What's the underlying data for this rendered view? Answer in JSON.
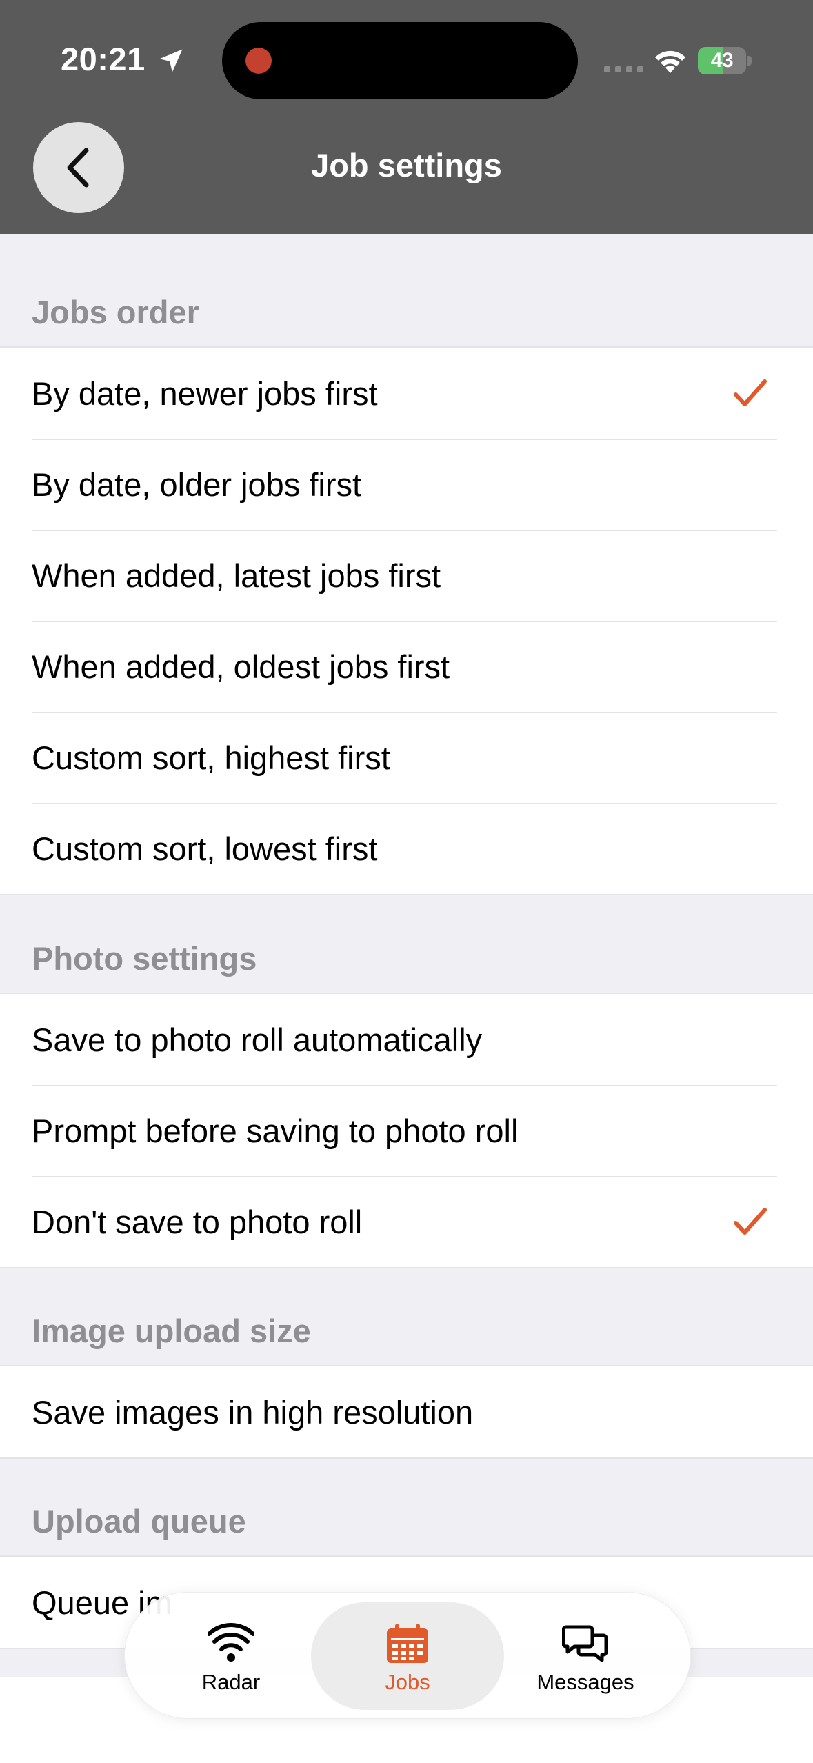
{
  "status": {
    "time": "20:21",
    "battery": "43"
  },
  "nav": {
    "title": "Job settings"
  },
  "sections": [
    {
      "header": "Jobs order",
      "items": [
        {
          "label": "By date, newer jobs first",
          "checked": true
        },
        {
          "label": "By date, older jobs first",
          "checked": false
        },
        {
          "label": "When added, latest jobs first",
          "checked": false
        },
        {
          "label": "When added, oldest jobs first",
          "checked": false
        },
        {
          "label": "Custom sort, highest first",
          "checked": false
        },
        {
          "label": "Custom sort, lowest first",
          "checked": false
        }
      ]
    },
    {
      "header": "Photo settings",
      "items": [
        {
          "label": "Save to photo roll automatically",
          "checked": false
        },
        {
          "label": "Prompt before saving to photo roll",
          "checked": false
        },
        {
          "label": "Don't save to photo roll",
          "checked": true
        }
      ]
    },
    {
      "header": "Image upload size",
      "items": [
        {
          "label": "Save images in high resolution",
          "checked": false
        }
      ]
    },
    {
      "header": "Upload queue",
      "items": [
        {
          "label": "Queue im",
          "checked": false
        }
      ]
    }
  ],
  "tabs": [
    {
      "label": "Radar",
      "icon": "wifi-icon",
      "active": false
    },
    {
      "label": "Jobs",
      "icon": "calendar-icon",
      "active": true
    },
    {
      "label": "Messages",
      "icon": "chat-bubbles-icon",
      "active": false
    }
  ],
  "colors": {
    "accent": "#e05a2b",
    "header_bg": "#5a5a5a",
    "section_header_text": "#8e8e93",
    "background": "#efeff4"
  }
}
